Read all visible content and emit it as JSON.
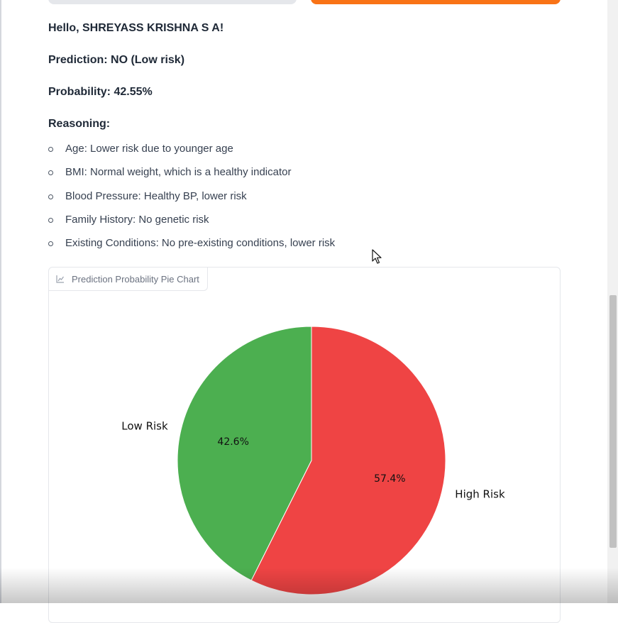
{
  "greeting": "Hello, SHREYASS KRISHNA S A!",
  "prediction": "Prediction: NO (Low risk)",
  "probability": "Probability: 42.55%",
  "reasoning": {
    "heading": "Reasoning:",
    "items": [
      "Age: Lower risk due to younger age",
      "BMI: Normal weight, which is a healthy indicator",
      "Blood Pressure: Healthy BP, lower risk",
      "Family History: No genetic risk",
      "Existing Conditions: No pre-existing conditions, lower risk"
    ]
  },
  "chart_panel": {
    "label": "Prediction Probability Pie Chart",
    "icon": "chart-icon"
  },
  "chart_data": {
    "type": "pie",
    "slices": [
      {
        "label": "Low Risk",
        "value": 42.6,
        "pct_label": "42.6%",
        "color": "#4caf50"
      },
      {
        "label": "High Risk",
        "value": 57.4,
        "pct_label": "57.4%",
        "color": "#ef4444"
      }
    ],
    "start_angle": 90,
    "direction": "counterclockwise"
  },
  "colors": {
    "accent_button": "#f97316",
    "low_risk": "#4caf50",
    "high_risk": "#ef4444"
  }
}
